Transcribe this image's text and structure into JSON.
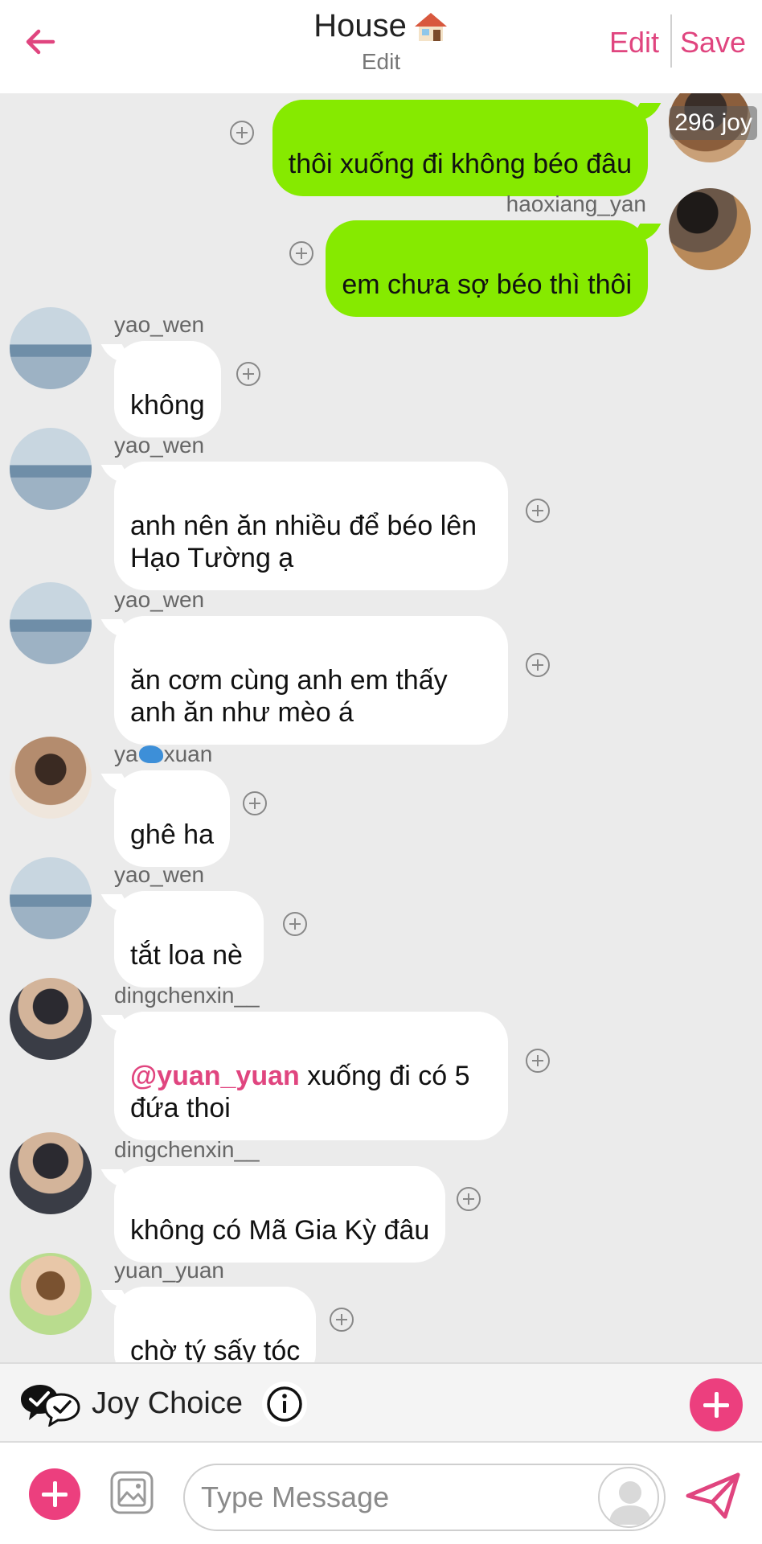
{
  "header": {
    "title": "House",
    "subtitle": "Edit",
    "edit_label": "Edit",
    "save_label": "Save",
    "accent_color": "#e0457f"
  },
  "messages": [
    {
      "user": "",
      "text": "thôi xuống đi không béo đâu",
      "badge": "296 joy"
    },
    {
      "user": "haoxiang_yan",
      "text": "em chưa sợ béo thì thôi"
    },
    {
      "user": "yao_wen",
      "text": "không"
    },
    {
      "user": "yao_wen",
      "text": "anh nên ăn nhiều để béo lên\nHạo Tường ạ"
    },
    {
      "user": "yao_wen",
      "text": "ăn cơm cùng anh em thấy\nanh ăn như mèo á"
    },
    {
      "user_prefix": "ya",
      "user_suffix": "xuan",
      "text": "ghê ha"
    },
    {
      "user": "yao_wen",
      "text": "tắt loa nè"
    },
    {
      "user": "dingchenxin__",
      "mention": "@yuan_yuan",
      "text": " xuống đi có 5\nđứa thoi"
    },
    {
      "user": "dingchenxin__",
      "text": "không có Mã Gia Kỳ đâu"
    },
    {
      "user": "yuan_yuan",
      "text": "chờ tý sấy tóc"
    }
  ],
  "joy_choice": {
    "label": "Joy Choice"
  },
  "input": {
    "placeholder": "Type Message"
  },
  "colors": {
    "bubble_out": "#86ea00",
    "bubble_in": "#ffffff",
    "button_pink": "#ec3f7e",
    "background": "#ebebeb"
  }
}
